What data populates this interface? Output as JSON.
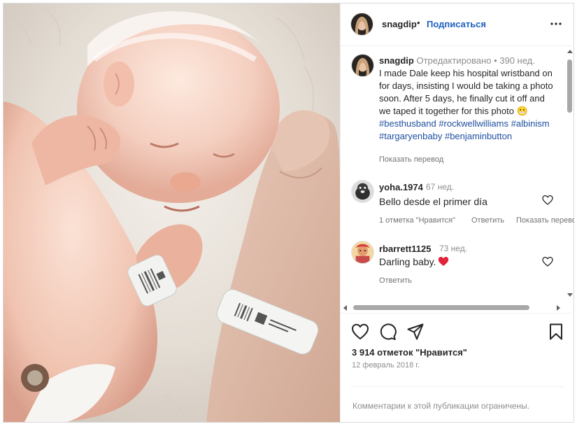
{
  "header": {
    "username": "snagdip",
    "separator": "•",
    "follow_label": "Подписаться",
    "more_icon": "more-horizontal-icon"
  },
  "caption": {
    "username": "snagdip",
    "edited": "Отредактировано",
    "separator": "•",
    "time": "390 нед.",
    "text": "I made Dale keep his hospital wristband on for days, insisting I would be taking a photo soon. After 5 days, he finally cut it off and we taped it together for this photo",
    "emoji": "😬",
    "hashtags": [
      "#besthusband",
      "#rockwellwilliams",
      "#albinism",
      "#targaryenbaby",
      "#benjaminbutton"
    ],
    "translate_label": "Показать перевод"
  },
  "comments": [
    {
      "username": "yoha.1974",
      "time": "67 нед.",
      "text": "Bello desde el primer día",
      "likes_label": "1 отметка \"Нравится\"",
      "reply_label": "Ответить",
      "translate_label": "Показать перевод"
    },
    {
      "username": "rbarrett1125",
      "time": "73 нед.",
      "text": "Darling baby.",
      "emoji_icon": "red-heart-emoji",
      "reply_label": "Ответить"
    }
  ],
  "actions": {
    "like_icon": "heart-icon",
    "comment_icon": "comment-icon",
    "share_icon": "paper-plane-icon",
    "save_icon": "bookmark-icon"
  },
  "likes_count": "3 914 отметок \"Нравится\"",
  "date": "12 февраль 2018 г.",
  "comments_limited": "Комментарии к этой публикации ограничены.",
  "colors": {
    "link_blue": "#1f5fbf",
    "hashtag_blue": "#1f4f9f",
    "muted_text": "#8e8e8e",
    "border": "#dbdbdb"
  }
}
